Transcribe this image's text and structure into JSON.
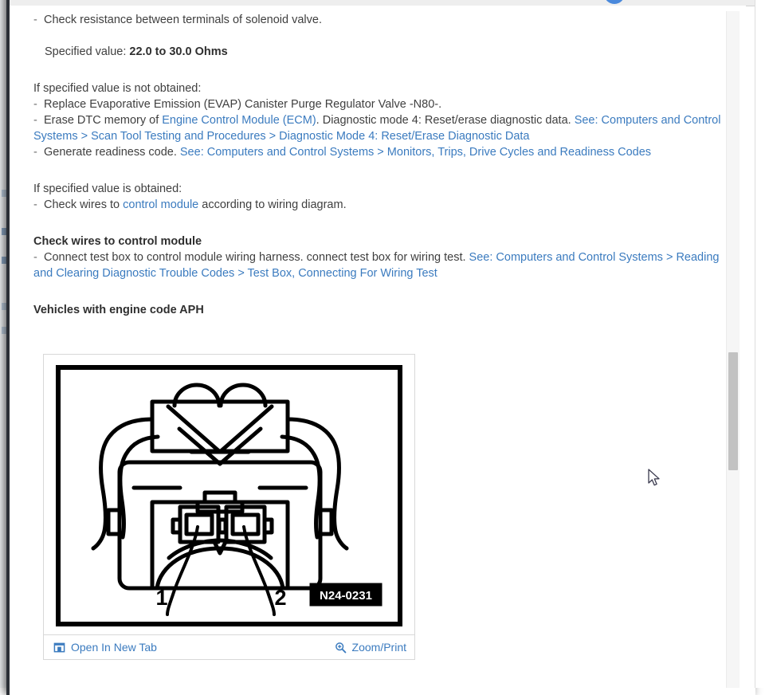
{
  "window": {
    "title_strip": "",
    "scrollbar": {
      "name": "vertical-scrollbar"
    }
  },
  "document": {
    "blocks": [
      {
        "type": "bullet",
        "text": "Check resistance between terminals of solenoid valve."
      },
      {
        "type": "spec",
        "label": "Specified value:",
        "value": "22.0 to 30.0 Ohms"
      },
      {
        "type": "heading_plain",
        "text": "If specified value is not obtained:"
      },
      {
        "type": "bullet",
        "text": "Replace Evaporative Emission (EVAP) Canister Purge Regulator Valve -N80-."
      },
      {
        "type": "bullet_mixed_1",
        "text": "Erase DTC memory of "
      },
      {
        "type": "heading_plain",
        "text": "If specified value is obtained:"
      },
      {
        "type": "bullet_mixed_2",
        "text": "Check wires to "
      },
      {
        "type": "heading_bold",
        "text": "Check wires to control module"
      },
      {
        "type": "bullet_mixed_3",
        "text": "Connect test box to control module wiring harness. connect test box for wiring test. "
      },
      {
        "type": "heading_bold",
        "text": "Vehicles with engine code APH"
      }
    ],
    "line1_bullet": "Check resistance between terminals of solenoid valve.",
    "spec_label": "Specified value:",
    "spec_value": "22.0 to 30.0 Ohms",
    "not_obtained_heading": "If specified value is not obtained:",
    "replace_valve_line": "Replace Evaporative Emission (EVAP) Canister Purge Regulator Valve -N80-.",
    "erase_dtc_prefix": "Erase DTC memory of ",
    "erase_dtc_link1": "Engine Control Module (ECM)",
    "erase_dtc_middle": ". Diagnostic mode 4: Reset/erase diagnostic data. ",
    "erase_dtc_link2": "See: Computers and Control Systems > Scan Tool Testing and Procedures > Diagnostic Mode 4: Reset/Erase Diagnostic Data",
    "readiness_prefix": "Generate readiness code. ",
    "readiness_link": "See: Computers and Control Systems > Monitors, Trips, Drive Cycles and Readiness Codes",
    "obtained_heading": "If specified value is obtained:",
    "check_wires_prefix": "Check wires to ",
    "check_wires_link": "control module",
    "check_wires_suffix": " according to wiring diagram.",
    "check_wires_heading": "Check wires to control module",
    "test_box_prefix": "Connect test box to control module wiring harness. connect test box for wiring test. ",
    "test_box_link": "See: Computers and Control Systems > Reading and Clearing Diagnostic Trouble Codes > Test Box, Connecting For Wiring Test",
    "engine_code_heading": "Vehicles with engine code APH"
  },
  "figure": {
    "caption_code": "N24-0231",
    "pin_label_1": "1",
    "pin_label_2": "2",
    "alt": "Two-pin electrical connector for EVAP canister purge regulator valve",
    "toolbar": {
      "open_new_tab_label": "Open In New Tab",
      "open_new_tab_icon": "external-link-icon",
      "zoom_print_label": "Zoom/Print",
      "zoom_print_icon": "magnifier-plus-icon"
    }
  },
  "colors": {
    "link": "#3b7bbf",
    "body_text": "#3f3f3f",
    "heading_text": "#2f2f2f",
    "accent_blue": "#4a89dc",
    "scroll_thumb": "#c2c2c2",
    "border": "#d8d8d8"
  }
}
